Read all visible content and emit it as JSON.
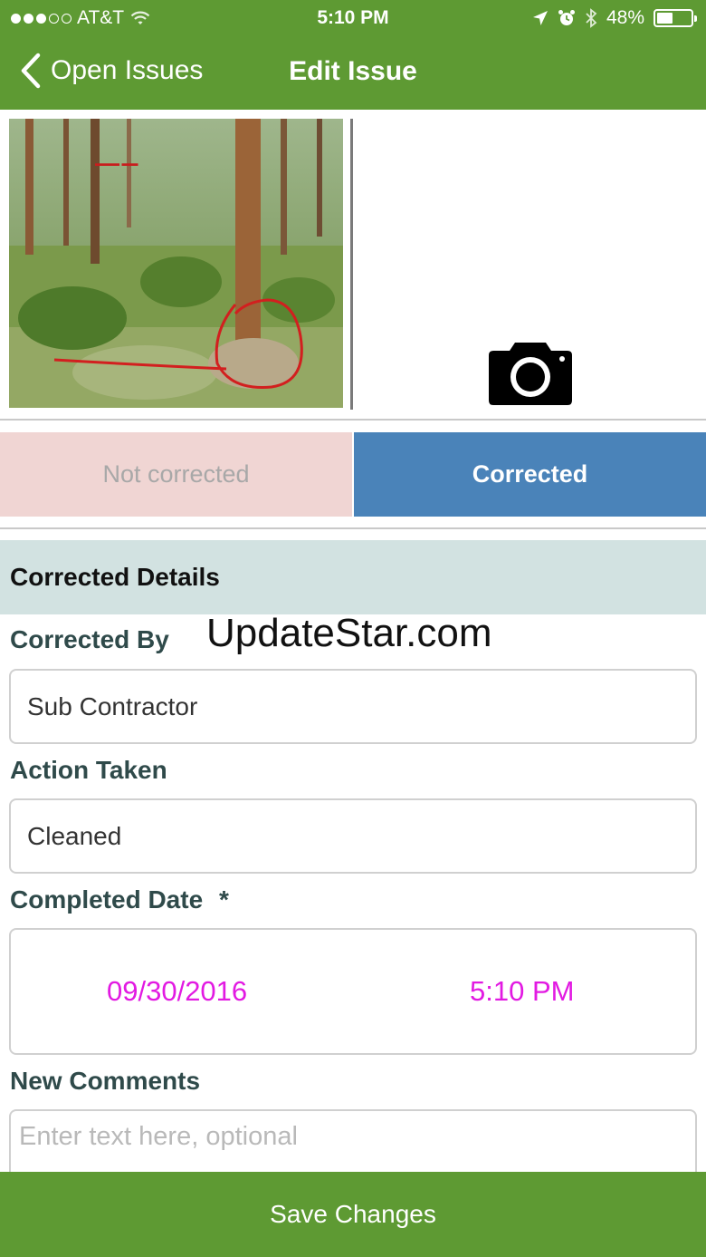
{
  "status_bar": {
    "carrier": "AT&T",
    "time": "5:10 PM",
    "battery": "48%",
    "battery_level": 0.48
  },
  "nav": {
    "back_label": "Open Issues",
    "title": "Edit Issue"
  },
  "segmented": {
    "not_corrected": "Not corrected",
    "corrected": "Corrected",
    "selected": "Corrected"
  },
  "section": {
    "title": "Corrected Details"
  },
  "watermark": "UpdateStar.com",
  "form": {
    "corrected_by_label": "Corrected By",
    "corrected_by_value": "Sub Contractor",
    "action_taken_label": "Action Taken",
    "action_taken_value": "Cleaned",
    "completed_date_label": "Completed Date",
    "required_marker": "*",
    "date_value": "09/30/2016",
    "time_value": "5:10 PM",
    "comments_label": "New Comments",
    "comments_placeholder": "Enter text here, optional"
  },
  "save_button": "Save Changes",
  "colors": {
    "brand_green": "#5e9a33",
    "selected_blue": "#4a83b9",
    "unselected_pink": "#f0d5d3",
    "date_magenta": "#e21ae2",
    "section_bg": "#d2e2e1"
  },
  "icons": {
    "back": "chevron-left-icon",
    "camera": "camera-icon",
    "wifi": "wifi-icon",
    "location": "location-arrow-icon",
    "alarm": "alarm-icon",
    "bluetooth": "bluetooth-icon",
    "battery": "battery-icon"
  }
}
